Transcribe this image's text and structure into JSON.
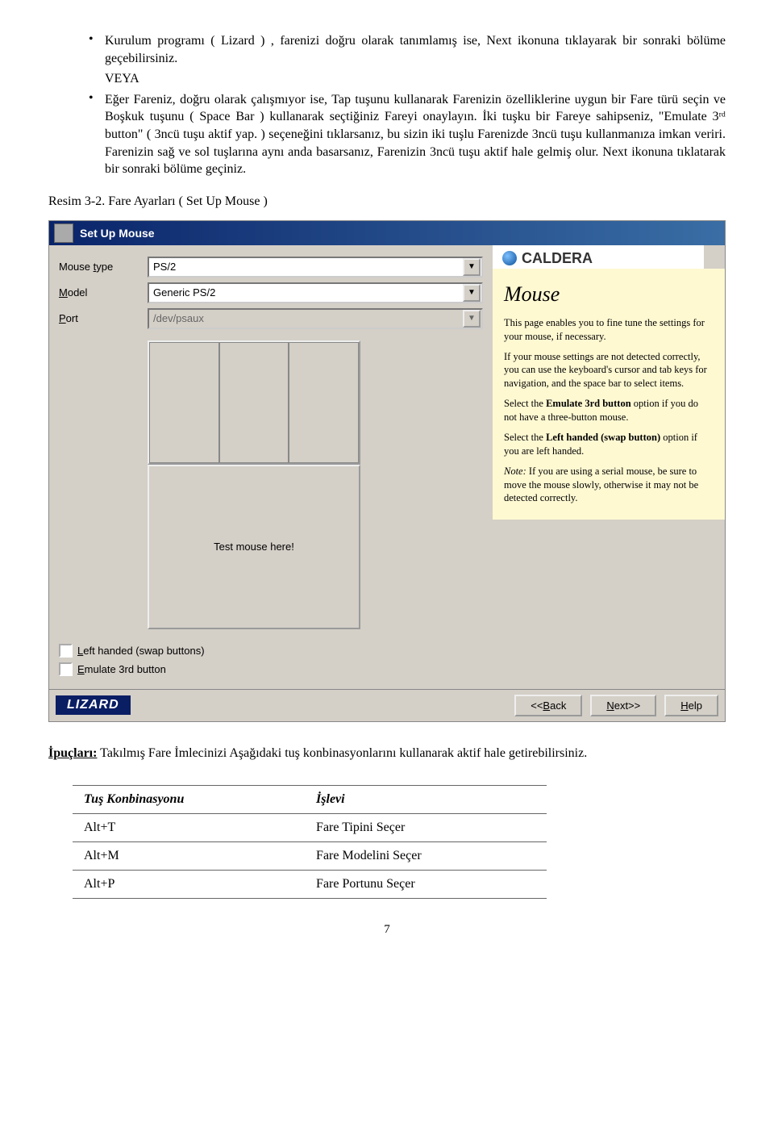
{
  "bullets": {
    "item1": "Kurulum programı ( Lizard ) , farenizi doğru olarak tanımlamış ise, Next ikonuna tıklayarak bir sonraki bölüme geçebilirsiniz.",
    "item2_prefix": "VEYA",
    "item2": "Eğer Fareniz, doğru olarak çalışmıyor ise, Tap tuşunu kullanarak Farenizin özelliklerine uygun bir Fare türü seçin ve Boşkuk tuşunu ( Space Bar ) kullanarak seçtiğiniz Fareyi onaylayın. İki tuşku bir Fareye sahipseniz, \"Emulate 3ʳᵈ button\" ( 3ncü tuşu aktif yap. ) seçeneğini tıklarsanız, bu sizin iki tuşlu Farenizde 3ncü tuşu kullanmanıza imkan veriri. Farenizin sağ ve sol tuşlarına aynı anda basarsanız, Farenizin 3ncü tuşu aktif hale gelmiş olur. Next ikonuna tıklatarak bir sonraki bölüme geçiniz."
  },
  "figure_caption": "Resim 3-2. Fare Ayarları ( Set Up Mouse )",
  "screenshot": {
    "title": "Set Up Mouse",
    "brand": "CALDERA",
    "form": {
      "mouse_type_label": "Mouse type",
      "mouse_type_value": "PS/2",
      "model_label": "Model",
      "model_value": "Generic PS/2",
      "port_label": "Port",
      "port_value": "/dev/psaux"
    },
    "test_label": "Test mouse here!",
    "checks": {
      "left_handed": "Left handed (swap buttons)",
      "emulate_3rd": "Emulate 3rd button"
    },
    "help": {
      "heading": "Mouse",
      "p1": "This page enables you to fine tune the settings for your mouse, if necessary.",
      "p2": "If your mouse settings are not detected correctly, you can use the keyboard's cursor and tab keys for navigation, and the space bar to select items.",
      "p3a": "Select the ",
      "p3b": "Emulate 3rd button",
      "p3c": " option if you do not have a three-button mouse.",
      "p4a": "Select the ",
      "p4b": "Left handed (swap button)",
      "p4c": " option if you are left handed.",
      "p5a": "Note:",
      "p5b": " If you are using a serial mouse, be sure to move the mouse slowly, otherwise it may not be detected correctly."
    },
    "footer": {
      "brand": "LIZARD",
      "back": "<<Back",
      "next": "Next>>",
      "help": "Help"
    }
  },
  "tips": {
    "label": "İpuçları:",
    "text": " Takılmış Fare İmlecinizi Aşağıdaki tuş konbinasyonlarını kullanarak aktif hale getirebilirsiniz."
  },
  "table": {
    "h1": "Tuş Konbinasyonu",
    "h2": "İşlevi",
    "rows": [
      {
        "k": "Alt+T",
        "v": "Fare Tipini Seçer"
      },
      {
        "k": "Alt+M",
        "v": "Fare Modelini Seçer"
      },
      {
        "k": "Alt+P",
        "v": "Fare Portunu Seçer"
      }
    ]
  },
  "page_number": "7"
}
